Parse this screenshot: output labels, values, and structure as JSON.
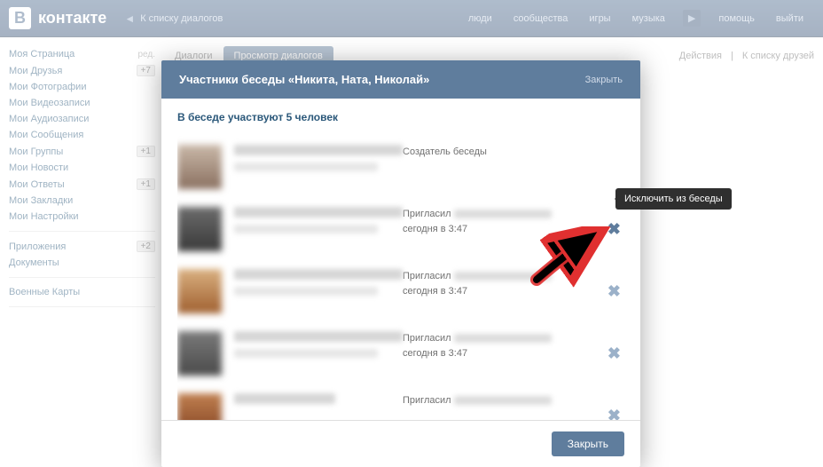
{
  "header": {
    "logo_letter": "В",
    "logo_text": "контакте",
    "back_label": "К списку диалогов",
    "nav": [
      "люди",
      "сообщества",
      "игры",
      "музыка"
    ],
    "help": "помощь",
    "logout": "выйти"
  },
  "sidebar": {
    "items": [
      {
        "label": "Моя Страница",
        "extra": "ред."
      },
      {
        "label": "Мои Друзья",
        "badge": "+7"
      },
      {
        "label": "Мои Фотографии"
      },
      {
        "label": "Мои Видеозаписи"
      },
      {
        "label": "Мои Аудиозаписи"
      },
      {
        "label": "Мои Сообщения"
      },
      {
        "label": "Мои Группы",
        "badge": "+1"
      },
      {
        "label": "Мои Новости"
      },
      {
        "label": "Мои Ответы",
        "badge": "+1"
      },
      {
        "label": "Мои Закладки"
      },
      {
        "label": "Мои Настройки"
      }
    ],
    "secondary": [
      {
        "label": "Приложения",
        "badge": "+2"
      },
      {
        "label": "Документы"
      }
    ],
    "tertiary": [
      {
        "label": "Военные Карты"
      }
    ]
  },
  "tabs": {
    "dialogs": "Диалоги",
    "view": "Просмотр диалогов",
    "actions": "Действия",
    "friends": "К списку друзей"
  },
  "modal": {
    "title": "Участники беседы «Никита, Ната, Николай»",
    "close": "Закрыть",
    "subtitle": "В беседе участвуют 5 человек",
    "creator_label": "Создатель беседы",
    "invited_prefix": "Пригласил",
    "invited_time": "сегодня в 3:47",
    "footer_btn": "Закрыть"
  },
  "tooltip": "Исключить из беседы"
}
